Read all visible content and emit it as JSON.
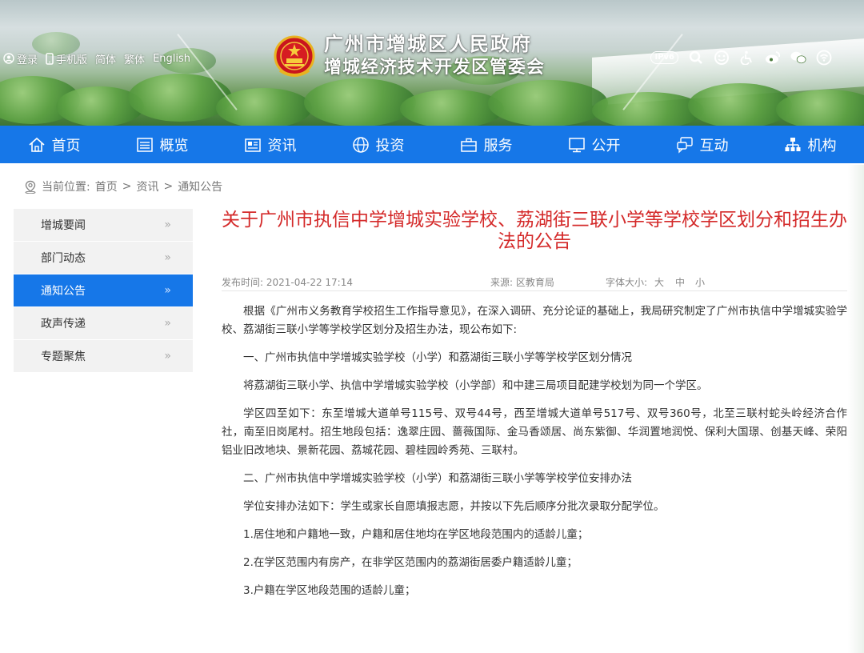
{
  "header": {
    "title_line1": "广州市增城区人民政府",
    "title_line2": "增城经济技术开发区管委会",
    "top_links": [
      "登录",
      "手机版",
      "简体",
      "繁体",
      "English"
    ],
    "ipv6": "IPv6",
    "right_icons": [
      "search-icon",
      "smiley-icon",
      "accessibility-icon",
      "weibo-icon",
      "wechat-icon",
      "wifi-icon"
    ]
  },
  "nav": {
    "items": [
      "首页",
      "概览",
      "资讯",
      "投资",
      "服务",
      "公开",
      "互动",
      "机构"
    ]
  },
  "breadcrumb": {
    "label": "当前位置:",
    "items": [
      "首页",
      "资讯",
      "通知公告"
    ],
    "separator": ">"
  },
  "sidebar": {
    "items": [
      "增城要闻",
      "部门动态",
      "通知公告",
      "政声传递",
      "专题聚焦"
    ],
    "active_index": 2,
    "chevron": "»"
  },
  "article": {
    "title": "关于广州市执信中学增城实验学校、荔湖街三联小学等学校学区划分和招生办法的公告",
    "date": "发布时间: 2021-04-22 17:14",
    "source": "来源: 区教育局",
    "font_size_label": "字体大小:",
    "font_sizes": [
      "大",
      "中",
      "小"
    ],
    "paragraphs": [
      "根据《广州市义务教育学校招生工作指导意见》，在深入调研、充分论证的基础上，我局研究制定了广州市执信中学增城实验学校、荔湖街三联小学等学校学区划分及招生办法，现公布如下:",
      "一、广州市执信中学增城实验学校（小学）和荔湖街三联小学等学校学区划分情况",
      "将荔湖街三联小学、执信中学增城实验学校（小学部）和中建三局项目配建学校划为同一个学区。",
      "学区四至如下：东至增城大道单号115号、双号44号，西至增城大道单号517号、双号360号，北至三联村蛇头岭经济合作社，南至旧岗尾村。招生地段包括：逸翠庄园、蔷薇国际、金马香颂居、尚东紫御、华润置地润悦、保利大国璟、创基天峰、荣阳铝业旧改地块、景新花园、荔城花园、碧桂园岭秀苑、三联村。",
      "二、广州市执信中学增城实验学校（小学）和荔湖街三联小学等学校学位安排办法",
      "学位安排办法如下：学生或家长自愿填报志愿，并按以下先后顺序分批次录取分配学位。",
      "1.居住地和户籍地一致，户籍和居住地均在学区地段范围内的适龄儿童；",
      "2.在学区范围内有房产，在非学区范围内的荔湖街居委户籍适龄儿童；",
      "3.户籍在学区地段范围的适龄儿童；"
    ]
  },
  "colors": {
    "nav_blue": "#1677e8",
    "title_red": "#d42a2a",
    "sidebar_bg": "#f2f2f2"
  }
}
